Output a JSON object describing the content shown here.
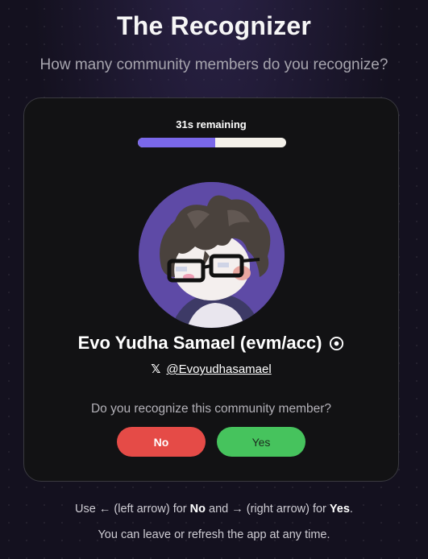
{
  "header": {
    "title": "The Recognizer",
    "subtitle": "How many community members do you recognize?"
  },
  "timer": {
    "label": "31s remaining",
    "progress_fraction": 0.52
  },
  "member": {
    "name": "Evo Yudha Samael (evm/acc)",
    "name_icon": "verified-circle-icon",
    "handle_icon": "x-logo-icon",
    "handle_icon_glyph": "𝕏",
    "handle": "@Evoyudhasamael"
  },
  "prompt": {
    "question": "Do you recognize this community member?",
    "no_label": "No",
    "yes_label": "Yes"
  },
  "instructions": {
    "part1": "Use ← (left arrow) for ",
    "no_word": "No",
    "part2": " and → (right arrow) for ",
    "yes_word": "Yes",
    "part3": ".",
    "footer": "You can leave or refresh the app at any time."
  },
  "colors": {
    "accent": "#7a68ea",
    "no_button": "#e54b47",
    "yes_button": "#46c35d",
    "avatar_bg": "#5e4aa6"
  }
}
